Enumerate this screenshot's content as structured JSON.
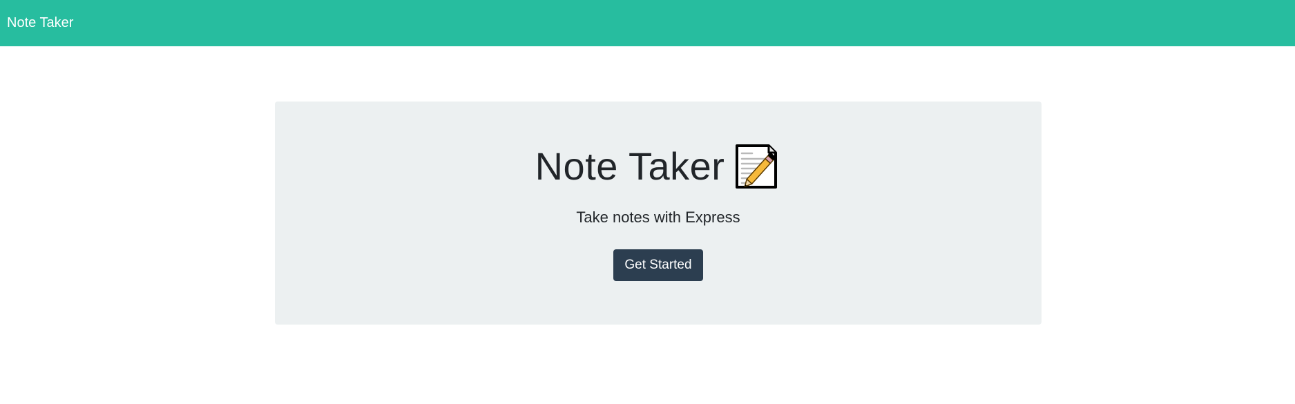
{
  "navbar": {
    "brand": "Note Taker",
    "background_color": "#27bd9f"
  },
  "hero": {
    "title": "Note Taker",
    "icon": "memo-icon",
    "subtitle": "Take notes with Express",
    "button_label": "Get Started",
    "button_color": "#2c3e50",
    "panel_color": "#ecf0f1"
  }
}
